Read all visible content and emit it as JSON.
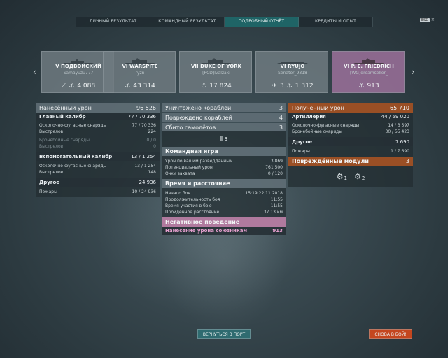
{
  "tabs": [
    {
      "label": "ЛИЧНЫЙ РЕЗУЛЬТАТ",
      "active": false
    },
    {
      "label": "КОМАНДНЫЙ РЕЗУЛЬТАТ",
      "active": false
    },
    {
      "label": "ПОДРОБНЫЙ ОТЧЁТ",
      "active": true
    },
    {
      "label": "КРЕДИТЫ И ОПЫТ",
      "active": false
    }
  ],
  "esc": {
    "key": "ESC",
    "icon": "close-icon"
  },
  "ships": [
    {
      "name": "V ПОДВОЙСКИЙ",
      "player": "Samayuzu777",
      "icons": [
        "torpedo-icon"
      ],
      "value": "4 088",
      "special": false
    },
    {
      "name": "VI WARSPITE",
      "player": "ryzn",
      "icons": [],
      "value": "43 314",
      "special": false
    },
    {
      "name": "VII DUKE OF YORK",
      "player": "[PCD]Ivalzaki",
      "icons": [],
      "value": "17 824",
      "special": false
    },
    {
      "name": "VI RYUJO",
      "player": "Senator_9318",
      "icons": [
        "plane-icon"
      ],
      "count": "3",
      "value": "1 312",
      "special": false
    },
    {
      "name": "VI P. E. FRIEDRICH",
      "player": "[WG]dreamseller_",
      "icons": [],
      "value": "913",
      "special": true
    }
  ],
  "damage": {
    "title": "Нанесённый урон",
    "total": "96 526",
    "main": {
      "label": "Главный калибр",
      "value": "77 / 70 336",
      "lines": [
        {
          "label": "Осколочно-фугасные снаряды",
          "value": "77 / 70 336",
          "dim": false
        },
        {
          "label": "Выстрелов",
          "value": "224",
          "dim": false
        },
        {
          "label": "Бронебойные снаряды",
          "value": "0 / 0",
          "dim": true
        },
        {
          "label": "Выстрелов",
          "value": "0",
          "dim": true
        }
      ]
    },
    "secondary": {
      "label": "Вспомогательный калибр",
      "value": "13 / 1 254",
      "lines": [
        {
          "label": "Осколочно-фугасные снаряды",
          "value": "13 / 1 254"
        },
        {
          "label": "Выстрелов",
          "value": "148"
        }
      ]
    },
    "other": {
      "label": "Другое",
      "value": "24 936",
      "lines": [
        {
          "label": "Пожары",
          "value": "10 / 24 936"
        }
      ]
    }
  },
  "kills": [
    {
      "label": "Уничтожено кораблей",
      "value": "3"
    },
    {
      "label": "Повреждено кораблей",
      "value": "4"
    },
    {
      "label": "Сбито самолётов",
      "value": "3"
    }
  ],
  "kills_icon_count": "3",
  "team": {
    "title": "Командная игра",
    "lines": [
      {
        "label": "Урон по вашим разведданным",
        "value": "3 869"
      },
      {
        "label": "Потенциальный урон",
        "value": "761 500"
      },
      {
        "label": "Очки захвата",
        "value": "0 / 120"
      }
    ]
  },
  "time": {
    "title": "Время и расстояние",
    "lines": [
      {
        "label": "Начало боя",
        "value": "15:19  22.11.2018"
      },
      {
        "label": "Продолжительность боя",
        "value": "11:55"
      },
      {
        "label": "Время участия в бою",
        "value": "11:55"
      },
      {
        "label": "Пройденное расстояние",
        "value": "37.13 км"
      }
    ]
  },
  "negative": {
    "title": "Негативное поведение",
    "label": "Нанесение урона союзникам",
    "value": "913"
  },
  "received": {
    "title": "Полученный урон",
    "total": "65 710",
    "artillery": {
      "label": "Артиллерия",
      "value": "44 / 59 020",
      "lines": [
        {
          "label": "Осколочно-фугасные снаряды",
          "value": "14 / 3 597"
        },
        {
          "label": "Бронебойные снаряды",
          "value": "30 / 55 423"
        }
      ]
    },
    "other": {
      "label": "Другое",
      "value": "7 690",
      "lines": [
        {
          "label": "Пожары",
          "value": "1 / 7 690"
        }
      ]
    }
  },
  "modules": {
    "title": "Повреждённые модули",
    "count": "3",
    "items": [
      {
        "icon": "gun-module-icon",
        "count": "1"
      },
      {
        "icon": "engine-module-icon",
        "count": "2"
      }
    ]
  },
  "buttons": {
    "port": "ВЕРНУТЬСЯ В ПОРТ",
    "battle": "СНОВА В БОЙ!"
  }
}
